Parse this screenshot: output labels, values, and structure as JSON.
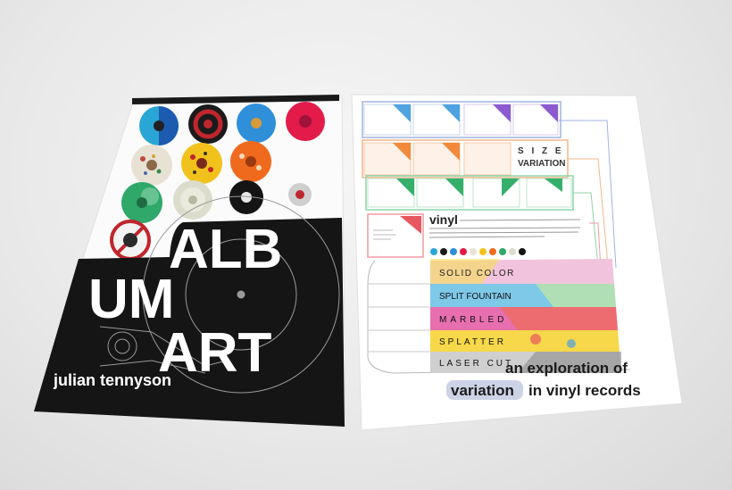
{
  "left_poster": {
    "title_line1": "ALB",
    "title_line2": "UM",
    "title_line3": "ART",
    "author": "julian tennyson"
  },
  "right_poster": {
    "heading": "vinyl",
    "size_heading": "S I Z E",
    "size_subheading": "VARIATION",
    "bands": [
      "SOLID COLOR",
      "SPLIT FOUNTAIN",
      "MARBLED",
      "SPLATTER",
      "LASER CUT"
    ],
    "tagline_line1": "an exploration of",
    "tagline_word_highlight": "variation",
    "tagline_line2_rest": "in vinyl records",
    "band_colors": [
      "#f2c3dc",
      "#7ec8e8",
      "#e76fb0",
      "#f6d84a",
      "#cfcfcf"
    ]
  }
}
